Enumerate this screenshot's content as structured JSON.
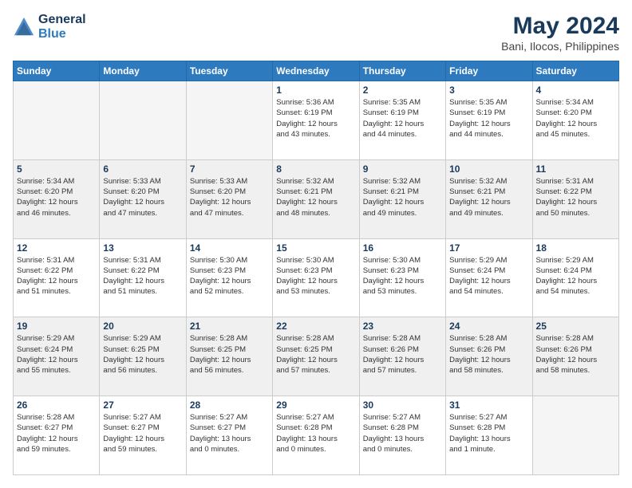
{
  "header": {
    "logo_line1": "General",
    "logo_line2": "Blue",
    "title": "May 2024",
    "subtitle": "Bani, Ilocos, Philippines"
  },
  "weekdays": [
    "Sunday",
    "Monday",
    "Tuesday",
    "Wednesday",
    "Thursday",
    "Friday",
    "Saturday"
  ],
  "weeks": [
    [
      {
        "day": "",
        "empty": true
      },
      {
        "day": "",
        "empty": true
      },
      {
        "day": "",
        "empty": true
      },
      {
        "day": "1",
        "info": "Sunrise: 5:36 AM\nSunset: 6:19 PM\nDaylight: 12 hours\nand 43 minutes."
      },
      {
        "day": "2",
        "info": "Sunrise: 5:35 AM\nSunset: 6:19 PM\nDaylight: 12 hours\nand 44 minutes."
      },
      {
        "day": "3",
        "info": "Sunrise: 5:35 AM\nSunset: 6:19 PM\nDaylight: 12 hours\nand 44 minutes."
      },
      {
        "day": "4",
        "info": "Sunrise: 5:34 AM\nSunset: 6:20 PM\nDaylight: 12 hours\nand 45 minutes."
      }
    ],
    [
      {
        "day": "5",
        "info": "Sunrise: 5:34 AM\nSunset: 6:20 PM\nDaylight: 12 hours\nand 46 minutes."
      },
      {
        "day": "6",
        "info": "Sunrise: 5:33 AM\nSunset: 6:20 PM\nDaylight: 12 hours\nand 47 minutes."
      },
      {
        "day": "7",
        "info": "Sunrise: 5:33 AM\nSunset: 6:20 PM\nDaylight: 12 hours\nand 47 minutes."
      },
      {
        "day": "8",
        "info": "Sunrise: 5:32 AM\nSunset: 6:21 PM\nDaylight: 12 hours\nand 48 minutes."
      },
      {
        "day": "9",
        "info": "Sunrise: 5:32 AM\nSunset: 6:21 PM\nDaylight: 12 hours\nand 49 minutes."
      },
      {
        "day": "10",
        "info": "Sunrise: 5:32 AM\nSunset: 6:21 PM\nDaylight: 12 hours\nand 49 minutes."
      },
      {
        "day": "11",
        "info": "Sunrise: 5:31 AM\nSunset: 6:22 PM\nDaylight: 12 hours\nand 50 minutes."
      }
    ],
    [
      {
        "day": "12",
        "info": "Sunrise: 5:31 AM\nSunset: 6:22 PM\nDaylight: 12 hours\nand 51 minutes."
      },
      {
        "day": "13",
        "info": "Sunrise: 5:31 AM\nSunset: 6:22 PM\nDaylight: 12 hours\nand 51 minutes."
      },
      {
        "day": "14",
        "info": "Sunrise: 5:30 AM\nSunset: 6:23 PM\nDaylight: 12 hours\nand 52 minutes."
      },
      {
        "day": "15",
        "info": "Sunrise: 5:30 AM\nSunset: 6:23 PM\nDaylight: 12 hours\nand 53 minutes."
      },
      {
        "day": "16",
        "info": "Sunrise: 5:30 AM\nSunset: 6:23 PM\nDaylight: 12 hours\nand 53 minutes."
      },
      {
        "day": "17",
        "info": "Sunrise: 5:29 AM\nSunset: 6:24 PM\nDaylight: 12 hours\nand 54 minutes."
      },
      {
        "day": "18",
        "info": "Sunrise: 5:29 AM\nSunset: 6:24 PM\nDaylight: 12 hours\nand 54 minutes."
      }
    ],
    [
      {
        "day": "19",
        "info": "Sunrise: 5:29 AM\nSunset: 6:24 PM\nDaylight: 12 hours\nand 55 minutes."
      },
      {
        "day": "20",
        "info": "Sunrise: 5:29 AM\nSunset: 6:25 PM\nDaylight: 12 hours\nand 56 minutes."
      },
      {
        "day": "21",
        "info": "Sunrise: 5:28 AM\nSunset: 6:25 PM\nDaylight: 12 hours\nand 56 minutes."
      },
      {
        "day": "22",
        "info": "Sunrise: 5:28 AM\nSunset: 6:25 PM\nDaylight: 12 hours\nand 57 minutes."
      },
      {
        "day": "23",
        "info": "Sunrise: 5:28 AM\nSunset: 6:26 PM\nDaylight: 12 hours\nand 57 minutes."
      },
      {
        "day": "24",
        "info": "Sunrise: 5:28 AM\nSunset: 6:26 PM\nDaylight: 12 hours\nand 58 minutes."
      },
      {
        "day": "25",
        "info": "Sunrise: 5:28 AM\nSunset: 6:26 PM\nDaylight: 12 hours\nand 58 minutes."
      }
    ],
    [
      {
        "day": "26",
        "info": "Sunrise: 5:28 AM\nSunset: 6:27 PM\nDaylight: 12 hours\nand 59 minutes."
      },
      {
        "day": "27",
        "info": "Sunrise: 5:27 AM\nSunset: 6:27 PM\nDaylight: 12 hours\nand 59 minutes."
      },
      {
        "day": "28",
        "info": "Sunrise: 5:27 AM\nSunset: 6:27 PM\nDaylight: 13 hours\nand 0 minutes."
      },
      {
        "day": "29",
        "info": "Sunrise: 5:27 AM\nSunset: 6:28 PM\nDaylight: 13 hours\nand 0 minutes."
      },
      {
        "day": "30",
        "info": "Sunrise: 5:27 AM\nSunset: 6:28 PM\nDaylight: 13 hours\nand 0 minutes."
      },
      {
        "day": "31",
        "info": "Sunrise: 5:27 AM\nSunset: 6:28 PM\nDaylight: 13 hours\nand 1 minute."
      },
      {
        "day": "",
        "empty": true
      }
    ]
  ]
}
